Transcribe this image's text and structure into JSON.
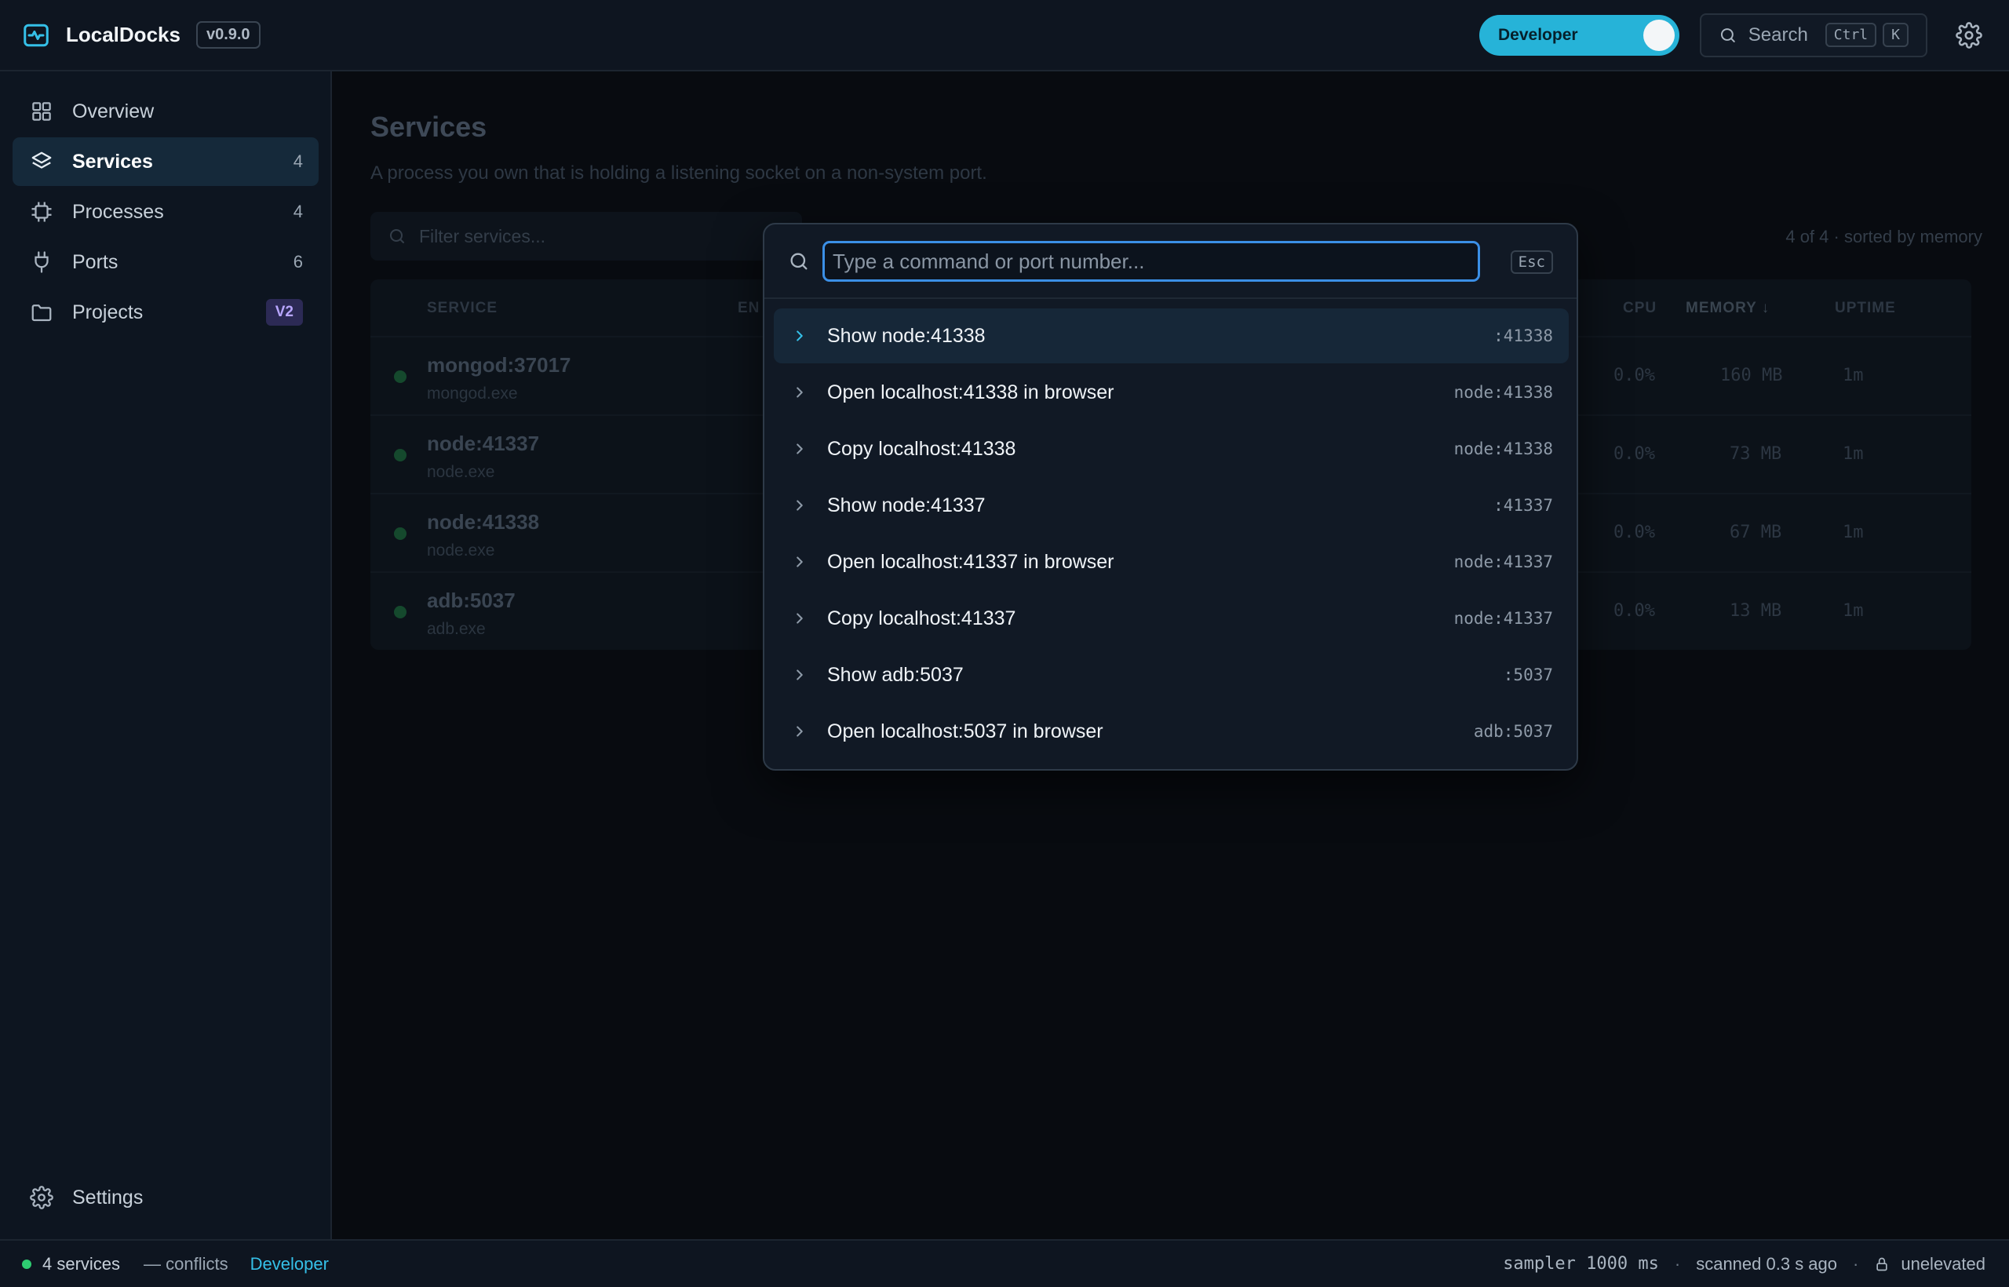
{
  "app": {
    "name": "LocalDocks",
    "version": "v0.9.0"
  },
  "topbar": {
    "mode_label": "Developer",
    "search_label": "Search",
    "search_keys": [
      "Ctrl",
      "K"
    ]
  },
  "sidebar": {
    "items": [
      {
        "label": "Overview",
        "count": "",
        "icon": "grid-icon"
      },
      {
        "label": "Services",
        "count": "4",
        "icon": "layers-icon"
      },
      {
        "label": "Processes",
        "count": "4",
        "icon": "cpu-icon"
      },
      {
        "label": "Ports",
        "count": "6",
        "icon": "plug-icon"
      },
      {
        "label": "Projects",
        "badge": "V2",
        "icon": "folder-icon"
      }
    ],
    "settings_label": "Settings"
  },
  "main": {
    "title": "Services",
    "subtitle": "A process you own that is holding a listening socket on a non-system port.",
    "filter_placeholder": "Filter services...",
    "sort_info": "4 of 4 · sorted by memory",
    "columns": {
      "service": "SERVICE",
      "endpoint": "EN",
      "cpu": "CPU",
      "memory": "MEMORY ↓",
      "uptime": "UPTIME"
    },
    "rows": [
      {
        "service": "mongod:37017",
        "exe": "mongod.exe",
        "cpu": "0.0%",
        "memory": "160 MB",
        "uptime": "1m"
      },
      {
        "service": "node:41337",
        "exe": "node.exe",
        "cpu": "0.0%",
        "memory": "73 MB",
        "uptime": "1m"
      },
      {
        "service": "node:41338",
        "exe": "node.exe",
        "cpu": "0.0%",
        "memory": "67 MB",
        "uptime": "1m"
      },
      {
        "service": "adb:5037",
        "exe": "adb.exe",
        "cpu": "0.0%",
        "memory": "13 MB",
        "uptime": "1m"
      }
    ]
  },
  "palette": {
    "placeholder": "Type a command or port number...",
    "value": "",
    "esc_label": "Esc",
    "commands": [
      {
        "label": "Show node:41338",
        "hint": ":41338"
      },
      {
        "label": "Open localhost:41338 in browser",
        "hint": "node:41338"
      },
      {
        "label": "Copy localhost:41338",
        "hint": "node:41338"
      },
      {
        "label": "Show node:41337",
        "hint": ":41337"
      },
      {
        "label": "Open localhost:41337 in browser",
        "hint": "node:41337"
      },
      {
        "label": "Copy localhost:41337",
        "hint": "node:41337"
      },
      {
        "label": "Show adb:5037",
        "hint": ":5037"
      },
      {
        "label": "Open localhost:5037 in browser",
        "hint": "adb:5037"
      }
    ]
  },
  "statusbar": {
    "services": "4 services",
    "conflicts": "— conflicts",
    "mode": "Developer",
    "sampler": "sampler 1000 ms",
    "scanned": "scanned 0.3 s ago",
    "elevation": "unelevated",
    "separator": "·"
  },
  "colors": {
    "accent": "#26b3d8",
    "focus": "#3b8fe6",
    "ok": "#2ecc71",
    "badge": "#b8a6ff"
  }
}
